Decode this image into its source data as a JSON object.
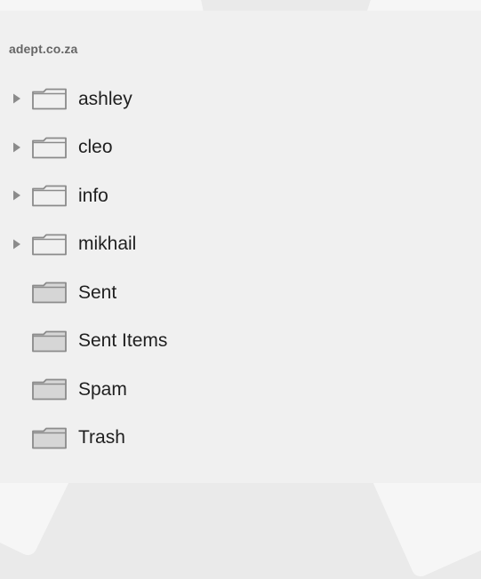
{
  "sidebar": {
    "account_title": "adept.co.za",
    "folders": [
      {
        "label": "ashley",
        "expandable": true,
        "icon": "folder-outline-icon"
      },
      {
        "label": "cleo",
        "expandable": true,
        "icon": "folder-outline-icon"
      },
      {
        "label": "info",
        "expandable": true,
        "icon": "folder-outline-icon"
      },
      {
        "label": "mikhail",
        "expandable": true,
        "icon": "folder-outline-icon"
      },
      {
        "label": "Sent",
        "expandable": false,
        "icon": "folder-filled-icon"
      },
      {
        "label": "Sent Items",
        "expandable": false,
        "icon": "folder-filled-icon"
      },
      {
        "label": "Spam",
        "expandable": false,
        "icon": "folder-filled-icon"
      },
      {
        "label": "Trash",
        "expandable": false,
        "icon": "folder-filled-icon"
      }
    ]
  },
  "colors": {
    "background": "#eaeaea",
    "sidebar": "#f0f0f0",
    "text": "#1f1f1f",
    "muted_text": "#666666",
    "folder_stroke": "#8b8b8b",
    "folder_fill": "#d6d6d6"
  }
}
